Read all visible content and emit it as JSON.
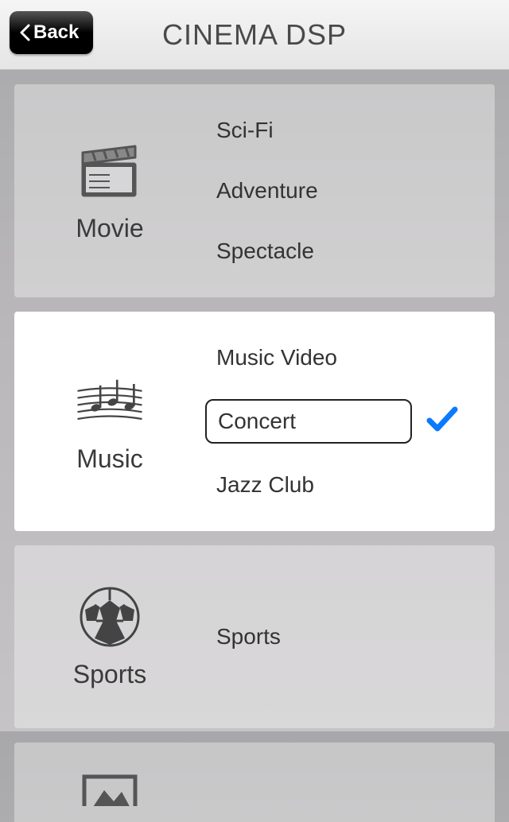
{
  "header": {
    "back_label": "Back",
    "title": "CINEMA DSP"
  },
  "sections": [
    {
      "id": "movie",
      "label": "Movie",
      "active": false,
      "icon": "clapper-icon",
      "items": [
        {
          "label": "Sci-Fi",
          "selected": false
        },
        {
          "label": "Adventure",
          "selected": false
        },
        {
          "label": "Spectacle",
          "selected": false
        }
      ]
    },
    {
      "id": "music",
      "label": "Music",
      "active": true,
      "icon": "music-staff-icon",
      "items": [
        {
          "label": "Music Video",
          "selected": false
        },
        {
          "label": "Concert",
          "selected": true
        },
        {
          "label": "Jazz Club",
          "selected": false
        }
      ]
    },
    {
      "id": "sports",
      "label": "Sports",
      "active": false,
      "icon": "soccer-ball-icon",
      "items": [
        {
          "label": "Sports",
          "selected": false
        }
      ]
    },
    {
      "id": "partial",
      "label": "",
      "active": false,
      "icon": "rectangle-icon",
      "items": []
    }
  ],
  "colors": {
    "accent": "#0a7aff"
  }
}
